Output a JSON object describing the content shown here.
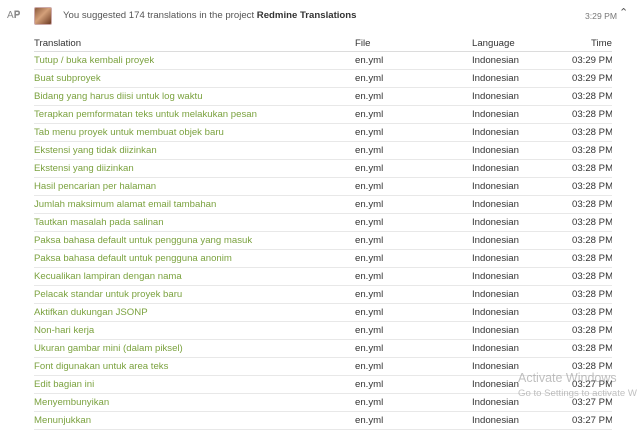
{
  "header": {
    "icon": "translate-icon",
    "text_prefix": "You suggested 174 translations in the project ",
    "project_name": "Redmine Translations",
    "time": "3:29 PM",
    "collapse_icon": "chevron-up-icon"
  },
  "table": {
    "columns": [
      "Translation",
      "File",
      "Language",
      "Time"
    ],
    "rows": [
      {
        "translation": "Tutup / buka kembali proyek",
        "file": "en.yml",
        "language": "Indonesian",
        "time": "03:29 PM"
      },
      {
        "translation": "Buat subproyek",
        "file": "en.yml",
        "language": "Indonesian",
        "time": "03:29 PM"
      },
      {
        "translation": "Bidang yang harus diisi untuk log waktu",
        "file": "en.yml",
        "language": "Indonesian",
        "time": "03:28 PM"
      },
      {
        "translation": "Terapkan pemformatan teks untuk melakukan pesan",
        "file": "en.yml",
        "language": "Indonesian",
        "time": "03:28 PM"
      },
      {
        "translation": "Tab menu proyek untuk membuat objek baru",
        "file": "en.yml",
        "language": "Indonesian",
        "time": "03:28 PM"
      },
      {
        "translation": "Ekstensi yang tidak diizinkan",
        "file": "en.yml",
        "language": "Indonesian",
        "time": "03:28 PM"
      },
      {
        "translation": "Ekstensi yang diizinkan",
        "file": "en.yml",
        "language": "Indonesian",
        "time": "03:28 PM"
      },
      {
        "translation": "Hasil pencarian per halaman",
        "file": "en.yml",
        "language": "Indonesian",
        "time": "03:28 PM"
      },
      {
        "translation": "Jumlah maksimum alamat email tambahan",
        "file": "en.yml",
        "language": "Indonesian",
        "time": "03:28 PM"
      },
      {
        "translation": "Tautkan masalah pada salinan",
        "file": "en.yml",
        "language": "Indonesian",
        "time": "03:28 PM"
      },
      {
        "translation": "Paksa bahasa default untuk pengguna yang masuk",
        "file": "en.yml",
        "language": "Indonesian",
        "time": "03:28 PM"
      },
      {
        "translation": "Paksa bahasa default untuk pengguna anonim",
        "file": "en.yml",
        "language": "Indonesian",
        "time": "03:28 PM"
      },
      {
        "translation": "Kecualikan lampiran dengan nama",
        "file": "en.yml",
        "language": "Indonesian",
        "time": "03:28 PM"
      },
      {
        "translation": "Pelacak standar untuk proyek baru",
        "file": "en.yml",
        "language": "Indonesian",
        "time": "03:28 PM"
      },
      {
        "translation": "Aktifkan dukungan JSONP",
        "file": "en.yml",
        "language": "Indonesian",
        "time": "03:28 PM"
      },
      {
        "translation": "Non-hari kerja",
        "file": "en.yml",
        "language": "Indonesian",
        "time": "03:28 PM"
      },
      {
        "translation": "Ukuran gambar mini (dalam piksel)",
        "file": "en.yml",
        "language": "Indonesian",
        "time": "03:28 PM"
      },
      {
        "translation": "Font digunakan untuk area teks",
        "file": "en.yml",
        "language": "Indonesian",
        "time": "03:28 PM"
      },
      {
        "translation": "Edit bagian ini",
        "file": "en.yml",
        "language": "Indonesian",
        "time": "03:27 PM"
      },
      {
        "translation": "Menyembunyikan",
        "file": "en.yml",
        "language": "Indonesian",
        "time": "03:27 PM"
      },
      {
        "translation": "Menunjukkan",
        "file": "en.yml",
        "language": "Indonesian",
        "time": "03:27 PM"
      }
    ]
  },
  "watermark": {
    "line1": "Activate Windows",
    "line2": "Go to Settings to activate W"
  },
  "colors": {
    "link": "#7ba23f",
    "text": "#333333",
    "border": "#e8e8e8"
  }
}
